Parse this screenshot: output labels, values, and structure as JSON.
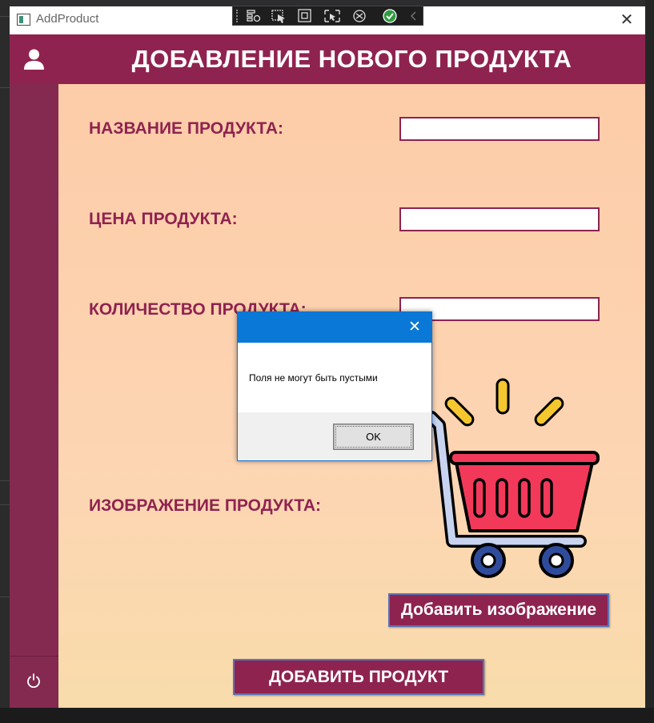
{
  "window": {
    "title": "AddProduct"
  },
  "header": {
    "title": "ДОБАВЛЕНИЕ НОВОГО ПРОДУКТА"
  },
  "form": {
    "fields": [
      {
        "label": "НАЗВАНИЕ ПРОДУКТА:",
        "value": ""
      },
      {
        "label": "ЦЕНА ПРОДУКТА:",
        "value": ""
      },
      {
        "label": "КОЛИЧЕСТВО ПРОДУКТА:",
        "value": ""
      }
    ],
    "image_label": "ИЗОБРАЖЕНИЕ ПРОДУКТА:",
    "add_image_button": "Добавить изображение",
    "add_product_button": "ДОБАВИТЬ ПРОДУКТ"
  },
  "dialog": {
    "message": "Поля не могут быть пустыми",
    "ok_button": "OK"
  },
  "colors": {
    "brand": "#8f2350",
    "sidebar": "#84294f",
    "content_bg": "#fdcca8",
    "dialog_titlebar": "#0a78d7"
  },
  "icons": {
    "sidebar_top": "user-icon",
    "sidebar_bottom": "power-icon",
    "product_image": "shopping-cart-icon"
  }
}
